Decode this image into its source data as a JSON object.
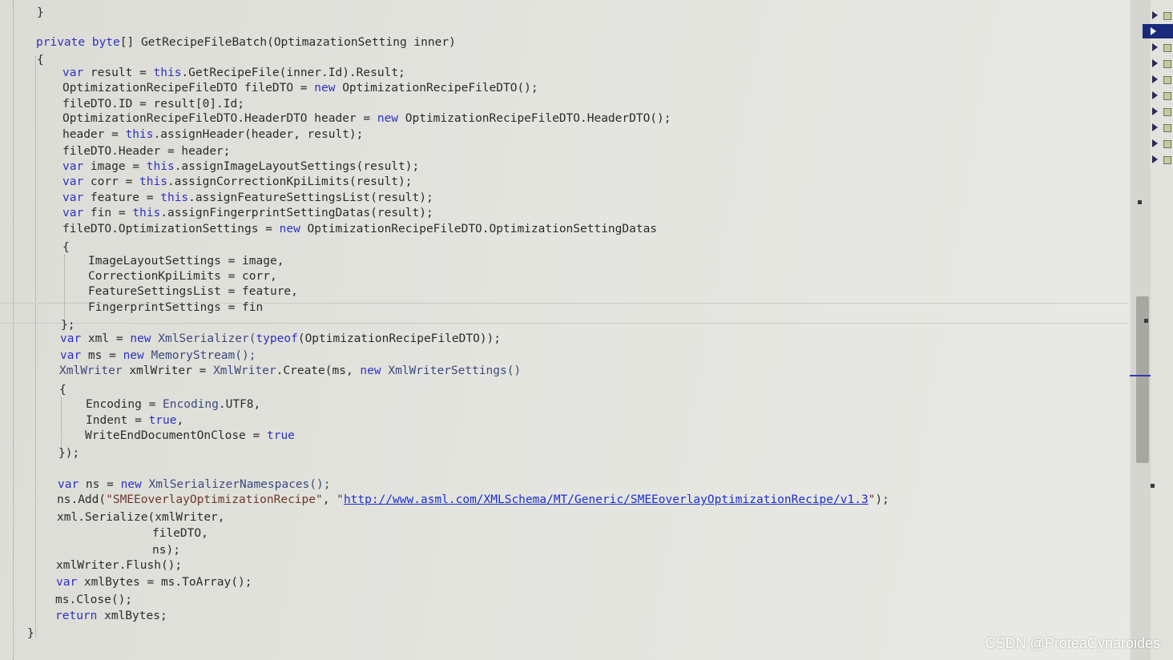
{
  "code_lines": [
    [
      {
        "t": "}",
        "c": "p"
      }
    ],
    [
      {
        "t": "private ",
        "c": "kw"
      },
      {
        "t": "byte",
        "c": "kw"
      },
      {
        "t": "[] GetRecipeFileBatch(OptimazationSetting inner)",
        "c": "p"
      }
    ],
    [
      {
        "t": "{",
        "c": "p"
      }
    ],
    [
      {
        "t": "var ",
        "c": "kw"
      },
      {
        "t": "result = ",
        "c": "p"
      },
      {
        "t": "this",
        "c": "kw"
      },
      {
        "t": ".GetRecipeFile(inner.Id).Result;",
        "c": "p"
      }
    ],
    [
      {
        "t": "OptimizationRecipeFileDTO fileDTO = ",
        "c": "p"
      },
      {
        "t": "new ",
        "c": "kw"
      },
      {
        "t": "OptimizationRecipeFileDTO();",
        "c": "p"
      }
    ],
    [
      {
        "t": "fileDTO.ID = result[0].Id;",
        "c": "p"
      }
    ],
    [
      {
        "t": "OptimizationRecipeFileDTO.HeaderDTO header = ",
        "c": "p"
      },
      {
        "t": "new ",
        "c": "kw"
      },
      {
        "t": "OptimizationRecipeFileDTO.HeaderDTO();",
        "c": "p"
      }
    ],
    [
      {
        "t": "header = ",
        "c": "p"
      },
      {
        "t": "this",
        "c": "kw"
      },
      {
        "t": ".assignHeader(header, result);",
        "c": "p"
      }
    ],
    [
      {
        "t": "fileDTO.Header = header;",
        "c": "p"
      }
    ],
    [
      {
        "t": "var ",
        "c": "kw"
      },
      {
        "t": "image = ",
        "c": "p"
      },
      {
        "t": "this",
        "c": "kw"
      },
      {
        "t": ".assignImageLayoutSettings(result);",
        "c": "p"
      }
    ],
    [
      {
        "t": "var ",
        "c": "kw"
      },
      {
        "t": "corr = ",
        "c": "p"
      },
      {
        "t": "this",
        "c": "kw"
      },
      {
        "t": ".assignCorrectionKpiLimits(result);",
        "c": "p"
      }
    ],
    [
      {
        "t": "var ",
        "c": "kw"
      },
      {
        "t": "feature = ",
        "c": "p"
      },
      {
        "t": "this",
        "c": "kw"
      },
      {
        "t": ".assignFeatureSettingsList(result);",
        "c": "p"
      }
    ],
    [
      {
        "t": "var ",
        "c": "kw"
      },
      {
        "t": "fin = ",
        "c": "p"
      },
      {
        "t": "this",
        "c": "kw"
      },
      {
        "t": ".assignFingerprintSettingDatas(result);",
        "c": "p"
      }
    ],
    [
      {
        "t": "fileDTO.OptimizationSettings = ",
        "c": "p"
      },
      {
        "t": "new ",
        "c": "kw"
      },
      {
        "t": "OptimizationRecipeFileDTO.OptimizationSettingDatas",
        "c": "p"
      }
    ],
    [
      {
        "t": "{",
        "c": "p"
      }
    ],
    [
      {
        "t": "ImageLayoutSettings = image,",
        "c": "p"
      }
    ],
    [
      {
        "t": "CorrectionKpiLimits = corr,",
        "c": "p"
      }
    ],
    [
      {
        "t": "FeatureSettingsList = feature,",
        "c": "p"
      }
    ],
    [
      {
        "t": "FingerprintSettings = fin",
        "c": "p"
      }
    ],
    [
      {
        "t": "};",
        "c": "p"
      }
    ],
    [
      {
        "t": "var ",
        "c": "kw"
      },
      {
        "t": "xml = ",
        "c": "p"
      },
      {
        "t": "new ",
        "c": "kw"
      },
      {
        "t": "XmlSerializer(",
        "c": "ty"
      },
      {
        "t": "typeof",
        "c": "kw"
      },
      {
        "t": "(OptimizationRecipeFileDTO));",
        "c": "p"
      }
    ],
    [
      {
        "t": "var ",
        "c": "kw"
      },
      {
        "t": "ms = ",
        "c": "p"
      },
      {
        "t": "new ",
        "c": "kw"
      },
      {
        "t": "MemoryStream();",
        "c": "ty"
      }
    ],
    [
      {
        "t": "XmlWriter ",
        "c": "ty"
      },
      {
        "t": "xmlWriter = ",
        "c": "p"
      },
      {
        "t": "XmlWriter",
        "c": "ty"
      },
      {
        "t": ".Create(ms, ",
        "c": "p"
      },
      {
        "t": "new ",
        "c": "kw"
      },
      {
        "t": "XmlWriterSettings()",
        "c": "ty"
      }
    ],
    [
      {
        "t": "{",
        "c": "p"
      }
    ],
    [
      {
        "t": "Encoding = ",
        "c": "p"
      },
      {
        "t": "Encoding",
        "c": "ty"
      },
      {
        "t": ".UTF8,",
        "c": "p"
      }
    ],
    [
      {
        "t": "Indent = ",
        "c": "p"
      },
      {
        "t": "true",
        "c": "kw"
      },
      {
        "t": ",",
        "c": "p"
      }
    ],
    [
      {
        "t": "WriteEndDocumentOnClose = ",
        "c": "p"
      },
      {
        "t": "true",
        "c": "kw"
      }
    ],
    [
      {
        "t": "});",
        "c": "p"
      }
    ],
    [
      {
        "t": "var ",
        "c": "kw"
      },
      {
        "t": "ns = ",
        "c": "p"
      },
      {
        "t": "new ",
        "c": "kw"
      },
      {
        "t": "XmlSerializerNamespaces();",
        "c": "ty"
      }
    ],
    [
      {
        "t": "ns.Add(",
        "c": "p"
      },
      {
        "t": "\"SMEEoverlayOptimizationRecipe\"",
        "c": "str"
      },
      {
        "t": ", ",
        "c": "p"
      },
      {
        "t": "\"",
        "c": "str"
      },
      {
        "t": "http://www.asml.com/XMLSchema/MT/Generic/SMEEoverlayOptimizationRecipe/v1.3",
        "c": "url"
      },
      {
        "t": "\"",
        "c": "str"
      },
      {
        "t": ");",
        "c": "p"
      }
    ],
    [
      {
        "t": "xml.Serialize(xmlWriter,",
        "c": "p"
      }
    ],
    [
      {
        "t": "fileDTO,",
        "c": "p"
      }
    ],
    [
      {
        "t": "ns);",
        "c": "p"
      }
    ],
    [
      {
        "t": "xmlWriter.Flush();",
        "c": "p"
      }
    ],
    [
      {
        "t": "var ",
        "c": "kw"
      },
      {
        "t": "xmlBytes = ms.ToArray();",
        "c": "p"
      }
    ],
    [
      {
        "t": "ms.Close();",
        "c": "p"
      }
    ],
    [
      {
        "t": "return ",
        "c": "kw"
      },
      {
        "t": "xmlBytes;",
        "c": "p"
      }
    ],
    [
      {
        "t": "}",
        "c": "p"
      }
    ]
  ],
  "watermark": "CSDN @ProteaCynaroides"
}
